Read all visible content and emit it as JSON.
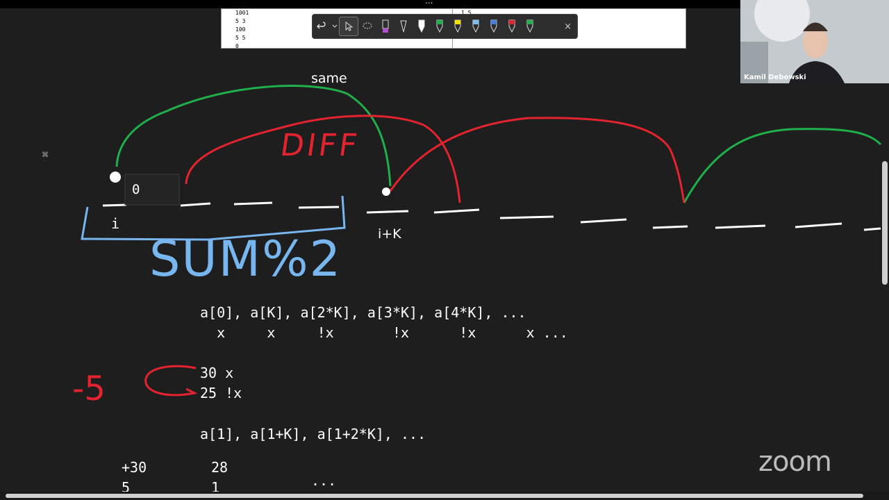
{
  "top_bar": {
    "menu_label": "..."
  },
  "input_panel": {
    "left_lines": "1001\n5 3\n100\n5 5\n0",
    "right_lines": "1 5"
  },
  "pen_toolbar": {
    "tools": [
      "undo-icon",
      "chevron-down-icon",
      "select-arrow-icon",
      "lasso-icon",
      "purple-highlighter-icon",
      "pen-icon",
      "white-marker-icon",
      "green-marker-icon",
      "yellow-marker-icon",
      "light-blue-marker-icon",
      "blue-marker-icon",
      "red-marker-icon",
      "green-pen-icon"
    ],
    "close_label": "×",
    "colors": {
      "purple": "#b24fd0",
      "white": "#ffffff",
      "green": "#21b14a",
      "yellow": "#f2e200",
      "light_blue": "#7cc0f3",
      "blue": "#4a7fd8",
      "red": "#e0252f"
    }
  },
  "webcam": {
    "participant_name": "Kamil Debowski"
  },
  "drawing": {
    "label_same": "same",
    "label_zero": "0",
    "label_i": "i",
    "label_ik": "i+K",
    "handwritten_diff": "DIFF",
    "handwritten_sum": "SUM%2",
    "handwritten_minus5": "-5",
    "colors": {
      "green": "#1fb04c",
      "red": "#e3232f",
      "blue": "#78b6f0",
      "white": "#ffffff"
    }
  },
  "text_block": {
    "line1": "a[0], a[K], a[2*K], a[3*K], a[4*K], ...",
    "line2": "  x     x     !x       !x      !x      x ...",
    "line3": "30 x",
    "line4": "25 !x",
    "line5": "a[1], a[1+K], a[1+2*K], ...",
    "line6a": "+30",
    "line6b": "28",
    "line7a": "5",
    "line7b": "1",
    "line7c": "..."
  },
  "zoom_logo": "zoom"
}
